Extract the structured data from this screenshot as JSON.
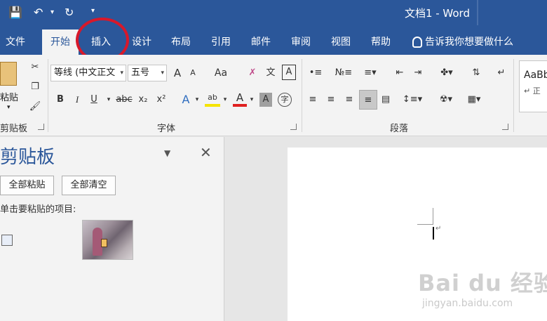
{
  "titlebar": {
    "doc_title": "文档1  -  Word"
  },
  "tabs": [
    {
      "label": "文件"
    },
    {
      "label": "开始",
      "active": true
    },
    {
      "label": "插入"
    },
    {
      "label": "设计"
    },
    {
      "label": "布局"
    },
    {
      "label": "引用"
    },
    {
      "label": "邮件"
    },
    {
      "label": "审阅"
    },
    {
      "label": "视图"
    },
    {
      "label": "帮助"
    }
  ],
  "tellme": {
    "label": "告诉我你想要做什么"
  },
  "ribbon": {
    "clipboard": {
      "paste_label": "粘贴",
      "group_label": "剪贴板"
    },
    "font": {
      "font_name": "等线 (中文正文",
      "font_size": "五号",
      "grow": "A",
      "shrink": "A",
      "case": "Aa",
      "bold": "B",
      "italic": "I",
      "underline": "U",
      "strike": "abc",
      "sub": "x₂",
      "sup": "x²",
      "effects": "A",
      "highlight": "ab",
      "color": "A",
      "shade": "A",
      "enclose": "字",
      "phonetic": "文",
      "border_char": "A",
      "group_label": "字体"
    },
    "paragraph": {
      "group_label": "段落"
    },
    "styles": {
      "preview": "AaBb",
      "preview2": "↵ 正"
    }
  },
  "clipboard_pane": {
    "title": "剪贴板",
    "paste_all": "全部粘贴",
    "clear_all": "全部清空",
    "hint": "单击要粘贴的项目:"
  },
  "watermark": {
    "brand": "Bai du 经验",
    "url": "jingyan.baidu.com"
  },
  "colors": {
    "word_blue": "#2b579a",
    "highlight_circle": "#d8182a"
  }
}
